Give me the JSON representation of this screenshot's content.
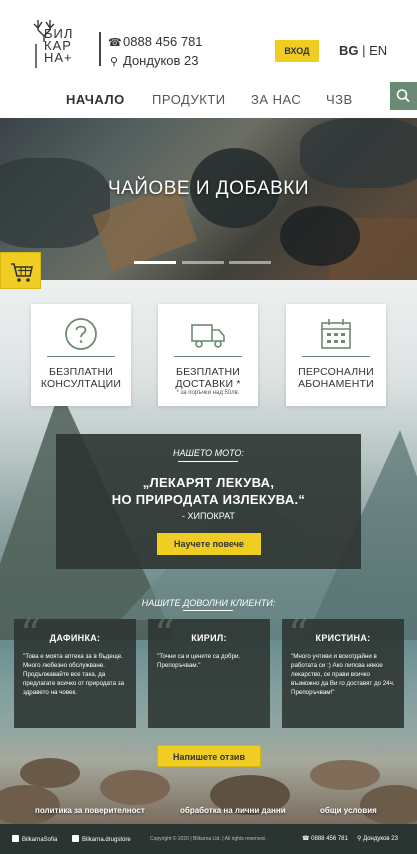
{
  "header": {
    "logo_lines": [
      "БИЛ",
      "КАР",
      "НА+"
    ],
    "phone": "0888 456 781",
    "address": "Дондуков 23",
    "login_label": "ВХОД",
    "lang_active": "BG",
    "lang_sep": " | ",
    "lang_other": "EN"
  },
  "nav": {
    "items": [
      {
        "label": "НАЧАЛО",
        "active": true
      },
      {
        "label": "ПРОДУКТИ"
      },
      {
        "label": "ЗА НАС"
      },
      {
        "label": "ЧЗВ"
      }
    ],
    "search_icon": "search-icon"
  },
  "hero": {
    "title": "ЧАЙОВЕ И ДОБАВКИ",
    "slides": 3,
    "active_slide": 1
  },
  "cart_icon": "cart-icon",
  "features": [
    {
      "icon": "question-icon",
      "title": [
        "БЕЗПЛАТНИ",
        "КОНСУЛТАЦИИ"
      ],
      "note": ""
    },
    {
      "icon": "truck-icon",
      "title": [
        "БЕЗПЛАТНИ",
        "ДОСТАВКИ *"
      ],
      "note": "* за поръчки над 50лв."
    },
    {
      "icon": "calendar-icon",
      "title": [
        "ПЕРСОНАЛНИ",
        "АБОНАМЕНТИ"
      ],
      "note": ""
    }
  ],
  "motto": {
    "label": "НАШЕТО МОТО:",
    "quote_line1": "„ЛЕКАРЯТ ЛЕКУВА,",
    "quote_line2": "НО ПРИРОДАТА ИЗЛЕКУВА.“",
    "author": "- ХИПОКРАТ",
    "button": "Научете повече"
  },
  "testimonials": {
    "title": "НАШИТЕ ДОВОЛНИ КЛИЕНТИ:",
    "items": [
      {
        "name": "ДАФИНКА:",
        "text": "\"Това е моята аптека за в бъдеще. Много любезно обслужване. Продължавайте все така, да предлагате всичко от природата за здравето на човек."
      },
      {
        "name": "КИРИЛ:",
        "text": "\"Точни са и цените са добри. Препоръчвам.\""
      },
      {
        "name": "КРИСТИНА:",
        "text": "\"Много учтиви и всеотдайни в работата си :) Ако липсва някое лекарство, се прави всичко възможно да Ви го доставят до 24ч. Препоръчвам!\""
      }
    ],
    "button": "Напишете отзив"
  },
  "footer_links": [
    "политика за поверителност",
    "обработка на лични данни",
    "общи условия"
  ],
  "bottom_bar": {
    "facebook": "BilkarnaSofia",
    "instagram": "Bilkarna.drugstore",
    "copyright": "Copyright © 2020  |  Bilkarna Ltd.  |  All rights reserved.",
    "phone": "0888 456 781",
    "address": "Дондуков 23"
  },
  "colors": {
    "accent": "#f0cd22",
    "green": "#6b8a74",
    "dark_panel": "#2c3431"
  }
}
